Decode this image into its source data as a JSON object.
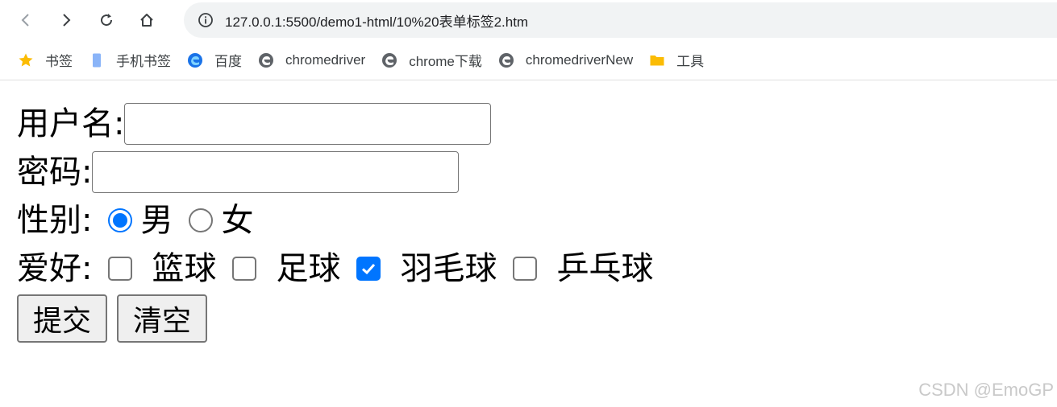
{
  "browser": {
    "url": "127.0.0.1:5500/demo1-html/10%20表单标签2.htm",
    "nav_icons": [
      "back-icon",
      "forward-icon",
      "reload-icon",
      "home-icon"
    ],
    "site_info_icon": "info-icon"
  },
  "bookmarks": [
    {
      "label": "书签",
      "icon": "star-icon",
      "color": "#fbbc04"
    },
    {
      "label": "手机书签",
      "icon": "phone-icon",
      "color": "#8ab4f8"
    },
    {
      "label": "百度",
      "icon": "edge-icon",
      "color": "#1a73e8"
    },
    {
      "label": "chromedriver",
      "icon": "edge-icon",
      "color": "#5f6368"
    },
    {
      "label": "chrome下载",
      "icon": "edge-icon",
      "color": "#5f6368"
    },
    {
      "label": "chromedriverNew",
      "icon": "edge-icon",
      "color": "#5f6368"
    },
    {
      "label": "工具",
      "icon": "folder-icon",
      "color": "#fbbc04"
    }
  ],
  "form": {
    "username_label": "用户名:",
    "username_value": "",
    "password_label": "密码:",
    "password_value": "",
    "gender_label": "性别:",
    "gender_options": [
      {
        "label": "男",
        "checked": true
      },
      {
        "label": "女",
        "checked": false
      }
    ],
    "hobby_label": "爱好:",
    "hobby_options": [
      {
        "label": "篮球",
        "checked": false
      },
      {
        "label": "足球",
        "checked": false
      },
      {
        "label": "羽毛球",
        "checked": true
      },
      {
        "label": "乒乓球",
        "checked": false
      }
    ],
    "submit_label": "提交",
    "reset_label": "清空"
  },
  "watermark": "CSDN @EmoGP",
  "colors": {
    "accent": "#0075ff",
    "omnibox_bg": "#f1f3f4"
  }
}
